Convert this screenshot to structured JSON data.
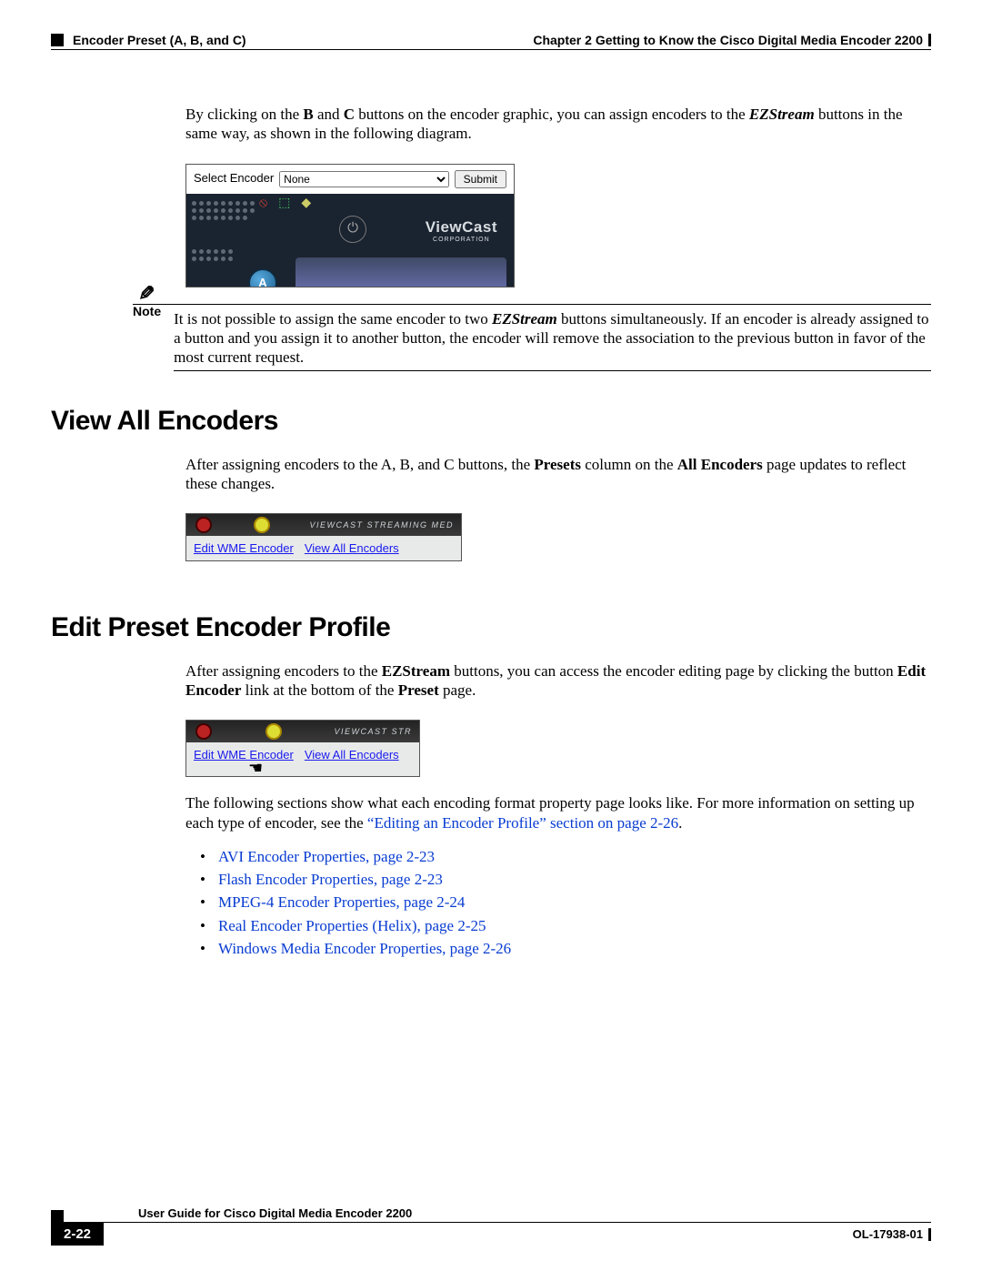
{
  "header": {
    "section": "Encoder Preset (A, B, and C)",
    "chapter": "Chapter 2      Getting to Know the Cisco Digital Media Encoder 2200"
  },
  "intro": {
    "t1": "By clicking on the ",
    "b1": "B",
    "t2": " and ",
    "b2": "C",
    "t3": " buttons on the encoder graphic, you can assign encoders to the ",
    "bi1": "EZStream",
    "t4": " buttons in the same way, as shown in the following diagram."
  },
  "ss1": {
    "label": "Select Encoder",
    "value": "None",
    "submit": "Submit",
    "brand": "ViewCast",
    "brand_sub": "CORPORATION",
    "ab": "A"
  },
  "note": {
    "label": "Note",
    "t1": "It is not possible to assign the same encoder to two ",
    "bi1": "EZStream",
    "t2": " buttons simultaneously. If an encoder is already assigned to a button and you assign it to another button, the encoder will remove the association to the previous button in favor of the most current request."
  },
  "sec1": {
    "title": "View All Encoders",
    "p_t1": "After assigning encoders to the A, B, and C buttons, the ",
    "p_b1": "Presets",
    "p_t2": " column on the ",
    "p_b2": "All Encoders",
    "p_t3": " page updates to reflect these changes."
  },
  "ss2": {
    "tab": "VIEWCAST STREAMING MED",
    "l1": "Edit WME Encoder",
    "l2": "View All Encoders"
  },
  "sec2": {
    "title": "Edit Preset Encoder Profile",
    "p_t1": "After assigning encoders to the ",
    "p_b1": "EZStream",
    "p_t2": " buttons, you can access the encoder editing page by clicking the button ",
    "p_b2": "Edit Encoder",
    "p_t3": " link at the bottom of the ",
    "p_b3": "Preset",
    "p_t4": " page."
  },
  "ss3": {
    "tab": "VIEWCAST STR",
    "l1": "Edit WME Encoder",
    "l2": "View All Encoders"
  },
  "after": {
    "t1": "The following sections show what each encoding format property page looks like. For more information on setting up each type of encoder, see the ",
    "link": "“Editing an Encoder Profile” section on page 2-26",
    "t2": "."
  },
  "bullets": [
    "AVI Encoder Properties, page 2-23",
    "Flash Encoder Properties, page 2-23",
    "MPEG-4 Encoder Properties, page 2-24",
    "Real Encoder Properties (Helix), page 2-25",
    "Windows Media Encoder Properties, page 2-26"
  ],
  "footer": {
    "title": "User Guide for Cisco Digital Media Encoder 2200",
    "page": "2-22",
    "doc": "OL-17938-01"
  }
}
